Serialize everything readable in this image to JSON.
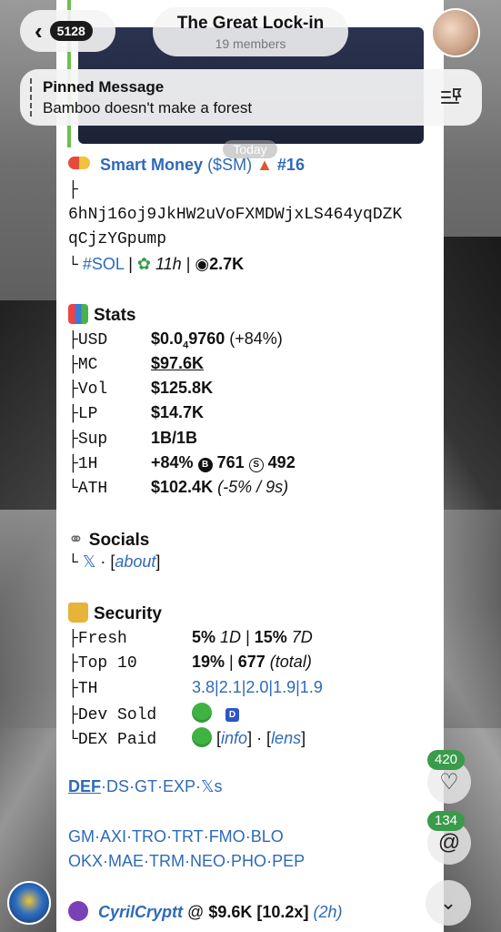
{
  "header": {
    "back_count": "5128",
    "title": "The Great Lock-in",
    "subtitle": "19 members"
  },
  "pinned": {
    "title": "Pinned Message",
    "message": "Bamboo doesn't make a forest"
  },
  "date_chip": "Today",
  "token": {
    "name": "Smart Money",
    "ticker": "($SM)",
    "rank": "#16",
    "address_line1": "6hNj16oj9JkHW2uVoFXMDWjxLS464yqDZK",
    "address_line2": "qCjzYGpump",
    "chain": "#SOL",
    "age": "11h",
    "views": "2.7K"
  },
  "stats": {
    "heading": "Stats",
    "usd_label": "USD",
    "usd_price": "$0.0",
    "usd_sub": "4",
    "usd_rest": "9760",
    "usd_change": "(+84%)",
    "mc_label": "MC",
    "mc": "$97.6K",
    "vol_label": "Vol",
    "vol": "$125.8K",
    "lp_label": "LP",
    "lp": "$14.7K",
    "sup_label": "Sup",
    "sup": "1B/1B",
    "h1_label": "1H",
    "h1_change": "+84%",
    "h1_buys": "761",
    "h1_sells": "492",
    "ath_label": "ATH",
    "ath": "$102.4K",
    "ath_note": "(-5% / 9s)"
  },
  "socials": {
    "heading": "Socials",
    "x": "𝕏",
    "about": "about"
  },
  "security": {
    "heading": "Security",
    "fresh_label": "Fresh",
    "fresh_1d": "5%",
    "fresh_1d_unit": "1D",
    "fresh_7d": "15%",
    "fresh_7d_unit": "7D",
    "top10_label": "Top 10",
    "top10_pct": "19%",
    "top10_total": "677",
    "top10_note": "(total)",
    "th_label": "TH",
    "th_values": "3.8|2.1|2.0|1.9|1.9",
    "devsold_label": "Dev Sold",
    "devsold_badge": "D",
    "dexpaid_label": "DEX Paid",
    "dex_info": "info",
    "dex_lens": "lens"
  },
  "links": {
    "row1": [
      "DEF",
      "DS",
      "GT",
      "EXP",
      "𝕏s"
    ],
    "row2": [
      "GM",
      "AXI",
      "TRO",
      "TRT",
      "FMO",
      "BLO"
    ],
    "row3": [
      "OKX",
      "MAE",
      "TRM",
      "NEO",
      "PHO",
      "PEP"
    ]
  },
  "caller": {
    "name": "CyrilCryptt",
    "at": "@",
    "mc": "$9.6K",
    "mult": "[10.2x]",
    "time": "(2h)"
  },
  "reactions": {
    "likes": "420",
    "mentions": "134"
  },
  "colors": {
    "link_blue": "#2e6ab8",
    "badge_green": "#3a9b4a",
    "status_green": "#3fb342"
  }
}
